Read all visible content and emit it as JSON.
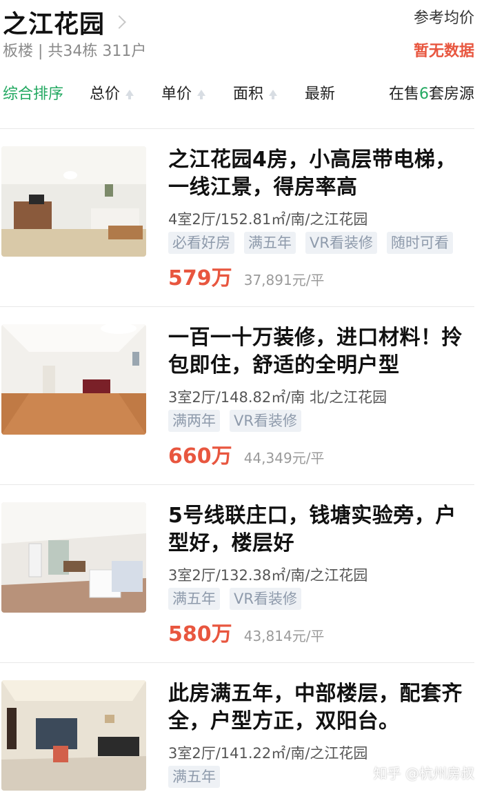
{
  "header": {
    "community_name": "之江花园",
    "subtitle": "板楼 | 共34栋 311户",
    "ref_price_label": "参考均价",
    "ref_price_value": "暂无数据"
  },
  "sort_bar": {
    "items": [
      {
        "label": "综合排序",
        "active": true
      },
      {
        "label": "总价"
      },
      {
        "label": "单价"
      },
      {
        "label": "面积"
      },
      {
        "label": "最新"
      }
    ],
    "on_sale_prefix": "在售",
    "on_sale_count": "6",
    "on_sale_suffix": "套房源"
  },
  "listings": [
    {
      "title": "之江花园4房，小高层带电梯，一线江景，得房率高",
      "meta": "4室2厅/152.81㎡/南/之江花园",
      "tags": [
        "必看好房",
        "满五年",
        "VR看装修",
        "随时可看"
      ],
      "price": "579万",
      "unit_price": "37,891元/平"
    },
    {
      "title": "一百一十万装修，进口材料！拎包即住，舒适的全明户型",
      "meta": "3室2厅/148.82㎡/南 北/之江花园",
      "tags": [
        "满两年",
        "VR看装修"
      ],
      "price": "660万",
      "unit_price": "44,349元/平"
    },
    {
      "title": "5号线联庄口，钱塘实验旁，户型好，楼层好",
      "meta": "3室2厅/132.38㎡/南/之江花园",
      "tags": [
        "满五年",
        "VR看装修"
      ],
      "price": "580万",
      "unit_price": "43,814元/平"
    },
    {
      "title": "此房满五年，中部楼层，配套齐全，户型方正，双阳台。",
      "meta": "3室2厅/141.22㎡/南/之江花园",
      "tags": [
        "满五年"
      ],
      "price": "",
      "unit_price": ""
    }
  ],
  "watermark": "知乎 @杭州房叔",
  "colors": {
    "accent_green": "#22a860",
    "price_red": "#e8563f",
    "tag_bg": "#eef1f5",
    "tag_text": "#8e9aab"
  }
}
